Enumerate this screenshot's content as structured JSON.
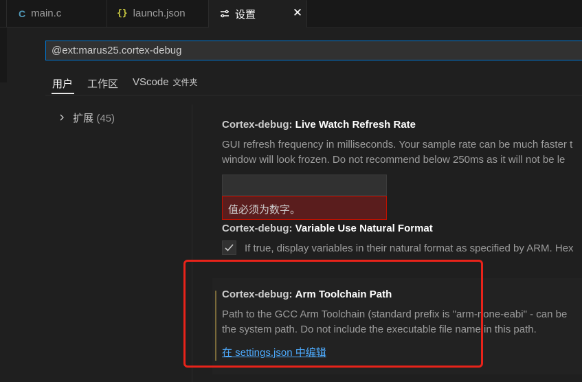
{
  "tabs": [
    {
      "icon": "C",
      "label": "main.c"
    },
    {
      "icon": "{}",
      "label": "launch.json"
    },
    {
      "icon": "⇄",
      "label": "设置"
    }
  ],
  "search": {
    "value": "@ext:marus25.cortex-debug"
  },
  "scopes": {
    "user": "用户",
    "workspace": "工作区",
    "folder_main": "VScode",
    "folder_suffix": "文件夹"
  },
  "tree": {
    "label": "扩展",
    "count": "(45)"
  },
  "settings": [
    {
      "category": "Cortex-debug:",
      "name": "Live Watch Refresh Rate",
      "desc_line1": "GUI refresh frequency in milliseconds. Your sample rate can be much faster t",
      "desc_line2": "window will look frozen. Do not recommend below 250ms as it will not be le",
      "value": "",
      "error": "值必须为数字。"
    },
    {
      "category": "Cortex-debug:",
      "name": "Variable Use Natural Format",
      "checked": true,
      "desc_line1": "If true, display variables in their natural format as specified by ARM. Hex"
    },
    {
      "category": "Cortex-debug:",
      "name": "Arm Toolchain Path",
      "desc_line1": "Path to the GCC Arm Toolchain (standard prefix is \"arm-none-eabi\" - can be",
      "desc_line2": "the system path. Do not include the executable file name in this path.",
      "link": "在 settings.json 中编辑"
    }
  ],
  "colors": {
    "accent": "#0078d4",
    "error_bg": "#5a1d1d",
    "error_border": "#be1100",
    "link": "#4daafc",
    "highlight": "#e8231a"
  }
}
